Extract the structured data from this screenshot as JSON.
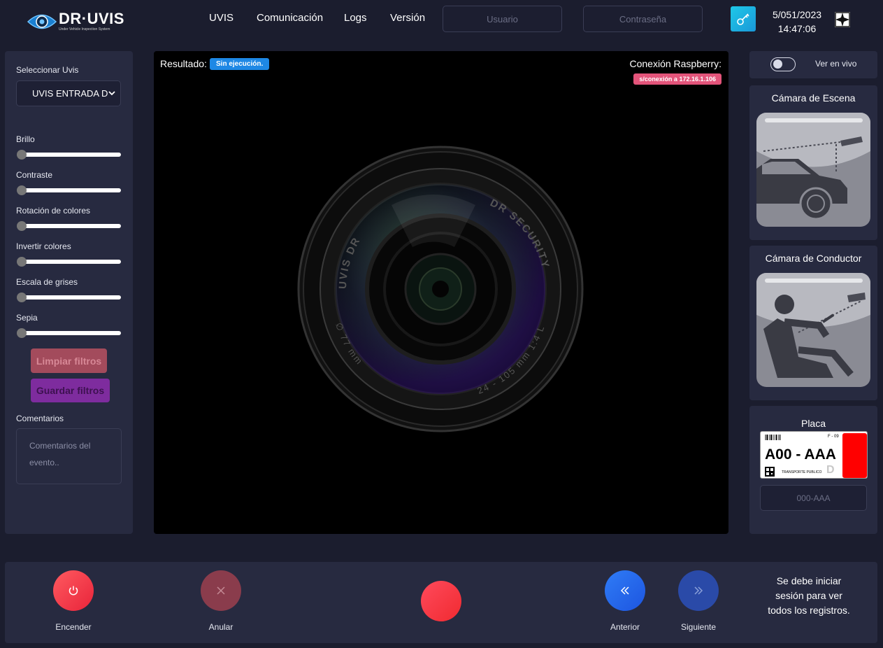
{
  "header": {
    "logo_text": "DR·UVIS",
    "logo_sub": "Under Vehicle Inspection System",
    "nav": [
      "UVIS",
      "Comunicación",
      "Logs",
      "Versión"
    ],
    "username_placeholder": "Usuario",
    "password_placeholder": "Contraseña",
    "date": "5/051/2023",
    "time": "14:47:06"
  },
  "left": {
    "select_label": "Seleccionar Uvis",
    "select_value": "UVIS ENTRADA DR",
    "filters": [
      "Brillo",
      "Contraste",
      "Rotación de colores",
      "Invertir colores",
      "Escala de grises",
      "Sepia"
    ],
    "filter_values": [
      0,
      0,
      0,
      0,
      0,
      0
    ],
    "clear_label": "Limpiar filtros",
    "save_label": "Guardar filtros",
    "comments_label": "Comentarios",
    "comments_placeholder": "Comentarios del evento.."
  },
  "viewer": {
    "result_label": "Resultado:",
    "result_badge": "Sin ejecución.",
    "connection_label": "Conexión Raspberry:",
    "connection_badge": "s/conexión a 172.16.1.106",
    "lens_text_top_left": "UVIS DR",
    "lens_text_top_right": "DR SECURITY",
    "lens_text_bottom_left": "∅ 77 mm",
    "lens_text_bottom_right": "24 - 105 mm 1:4 L"
  },
  "right": {
    "live_label": "Ver en vivo",
    "scene_title": "Cámara de Escena",
    "driver_title": "Cámara de Conductor",
    "plate_title": "Placa",
    "plate_text": "A00 - AAA",
    "plate_code": "F - 09",
    "plate_footer": "TRANSPORTE PUBLICO",
    "plate_watermark": "D",
    "plate_input_placeholder": "000-AAA"
  },
  "bottom": {
    "power_label": "Encender",
    "cancel_label": "Anular",
    "prev_label": "Anterior",
    "next_label": "Siguiente",
    "notice": "Se debe iniciar sesión para ver todos los registros."
  },
  "colors": {
    "background": "#1b1d2e",
    "panel": "#272a40",
    "accent_blue": "#1e88e5",
    "accent_pink": "#e3547a",
    "power_red": "#f5323f",
    "key_cyan": "#1ec8e8"
  },
  "icons": [
    "eye-logo-icon",
    "key-icon",
    "flag-icon",
    "chevron-down-icon",
    "power-icon",
    "close-icon",
    "double-chevron-left-icon",
    "double-chevron-right-icon"
  ]
}
